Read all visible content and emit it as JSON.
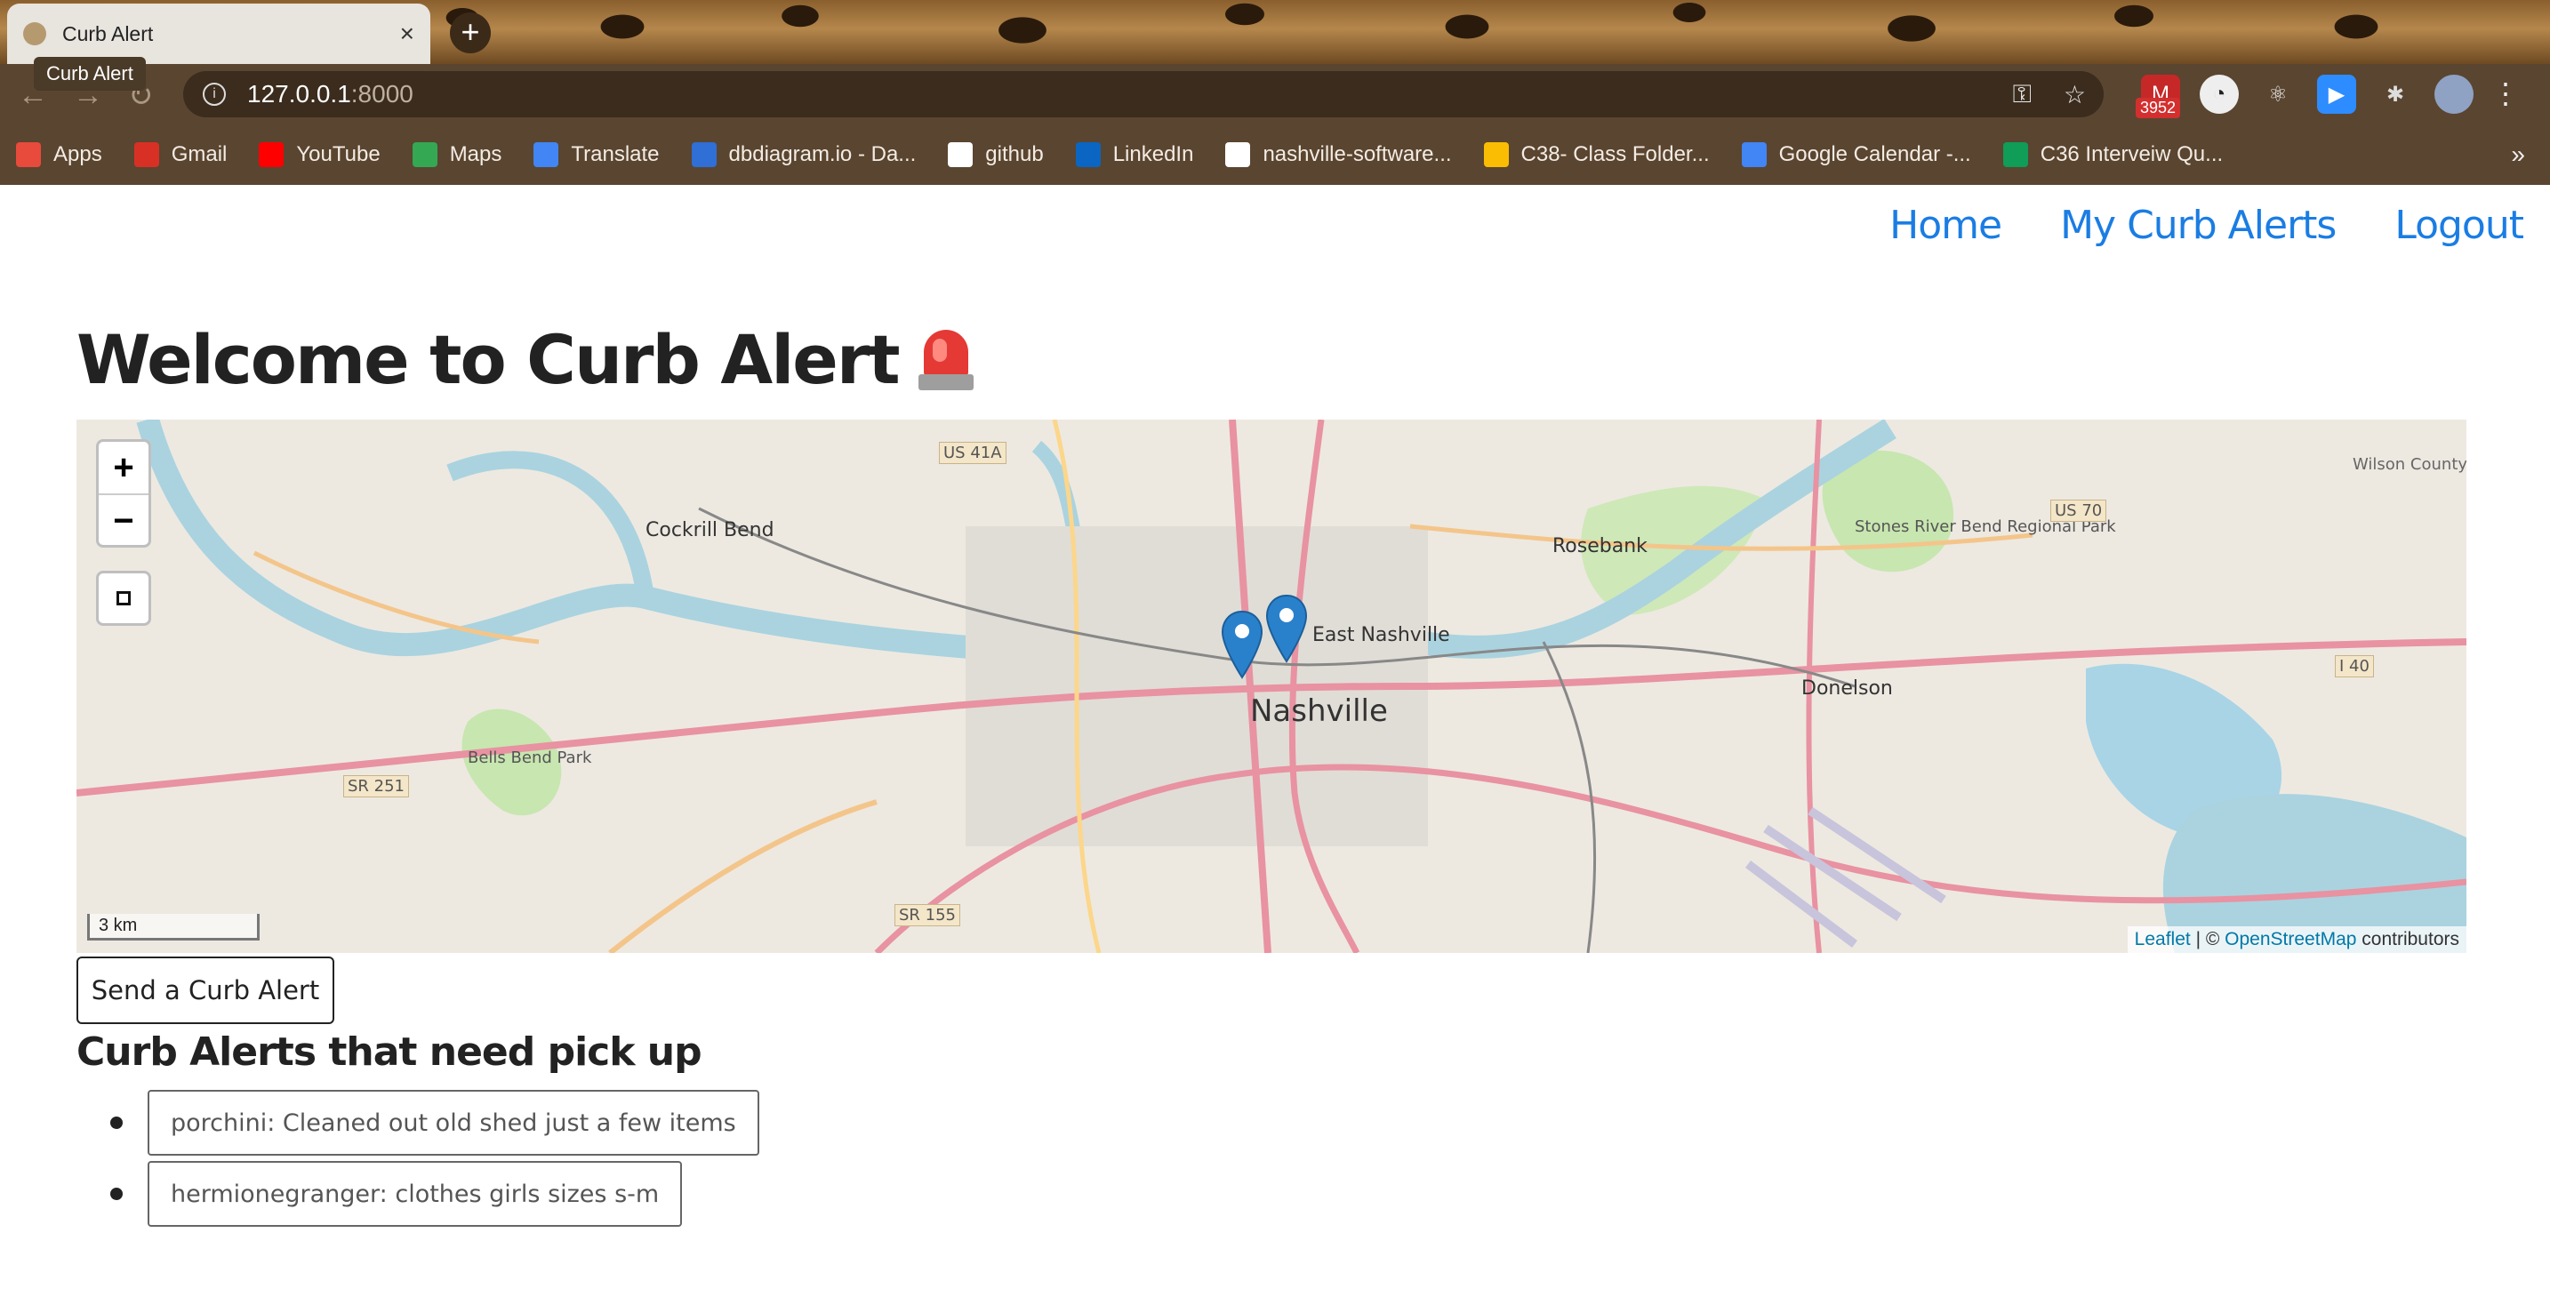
{
  "browser": {
    "tab_title": "Curb Alert",
    "tooltip": "Curb Alert",
    "url_host": "127.0.0.1",
    "url_port": ":8000",
    "gmail_badge": "3952",
    "bookmarks": [
      {
        "label": "Apps",
        "icon": "apps-grid-icon",
        "color": "#e84a3c"
      },
      {
        "label": "Gmail",
        "icon": "gmail-icon",
        "color": "#d93025"
      },
      {
        "label": "YouTube",
        "icon": "youtube-icon",
        "color": "#ff0000"
      },
      {
        "label": "Maps",
        "icon": "maps-icon",
        "color": "#34a853"
      },
      {
        "label": "Translate",
        "icon": "translate-icon",
        "color": "#4285f4"
      },
      {
        "label": "dbdiagram.io - Da...",
        "icon": "dbdiagram-icon",
        "color": "#2f6fd6"
      },
      {
        "label": "github",
        "icon": "github-icon",
        "color": "#ffffff"
      },
      {
        "label": "LinkedIn",
        "icon": "linkedin-icon",
        "color": "#0a66c2"
      },
      {
        "label": "nashville-software...",
        "icon": "github-icon",
        "color": "#ffffff"
      },
      {
        "label": "C38- Class Folder...",
        "icon": "google-drive-icon",
        "color": "#fbbc04"
      },
      {
        "label": "Google Calendar -...",
        "icon": "calendar-icon",
        "color": "#4285f4"
      },
      {
        "label": "C36 Interveiw Qu...",
        "icon": "sheets-icon",
        "color": "#0f9d58"
      }
    ]
  },
  "nav": {
    "home": "Home",
    "my_alerts": "My Curb Alerts",
    "logout": "Logout"
  },
  "page": {
    "title": "Welcome to Curb Alert",
    "title_icon": "siren-icon",
    "accent_color": "#1a7de3"
  },
  "map": {
    "zoom_in": "+",
    "zoom_out": "−",
    "scale": "3 km",
    "attribution_leaflet": "Leaflet",
    "attribution_sep": " | © ",
    "attribution_osm": "OpenStreetMap",
    "attribution_tail": " contributors",
    "place_labels": [
      "Nashville",
      "East Nashville",
      "Cockrill Bend",
      "Rosebank",
      "Donelson",
      "Bells Bend Park",
      "Stones River Bend Regional Park",
      "Wilson County",
      "US 41A",
      "US 70",
      "SR 251",
      "SR 155",
      "I 40"
    ],
    "marker_color": "#2a81cb"
  },
  "send_button": "Send a Curb Alert",
  "section_heading": "Curb Alerts that need pick up",
  "alerts": [
    "porchini: Cleaned out old shed just a few items",
    "hermionegranger: clothes girls sizes s-m"
  ]
}
